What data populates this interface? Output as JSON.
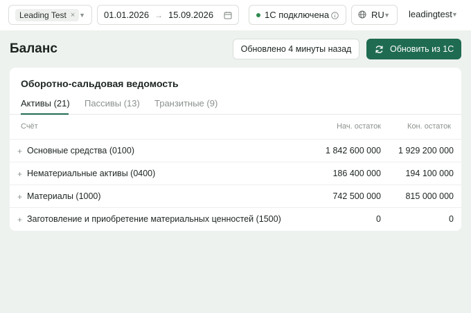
{
  "topbar": {
    "company_chip": "Leading Test",
    "date_from": "01.01.2026",
    "date_to": "15.09.2026",
    "connection_status": "1С подключена",
    "language": "RU",
    "user": "leadingtest"
  },
  "header": {
    "title": "Баланс",
    "updated_text": "Обновлено 4 минуты назад",
    "refresh_label": "Обновить из 1С"
  },
  "card": {
    "title": "Оборотно-сальдовая ведомость",
    "tabs": [
      {
        "label": "Активы (21)",
        "active": true
      },
      {
        "label": "Пассивы (13)",
        "active": false
      },
      {
        "label": "Транзитные (9)",
        "active": false
      }
    ],
    "columns": {
      "account": "Счёт",
      "start": "Нач. остаток",
      "end": "Кон. остаток"
    },
    "rows": [
      {
        "name": "Основные средства (0100)",
        "start": "1 842 600 000",
        "end": "1 929 200 000"
      },
      {
        "name": "Нематериальные активы (0400)",
        "start": "186 400 000",
        "end": "194 100 000"
      },
      {
        "name": "Материалы (1000)",
        "start": "742 500 000",
        "end": "815 000 000"
      },
      {
        "name": "Заготовление и приобретение материальных ценностей (1500)",
        "start": "0",
        "end": "0"
      }
    ]
  },
  "colors": {
    "accent": "#1f6b51",
    "status_ok": "#2e8b4f",
    "background": "#eef2ef"
  }
}
